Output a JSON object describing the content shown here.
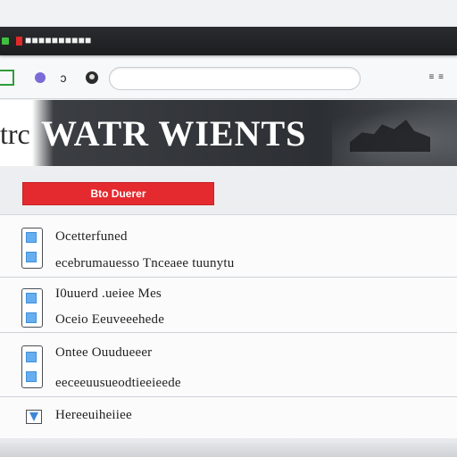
{
  "window": {
    "title": "■■■■■■■■■■"
  },
  "toolbar": {
    "refresh_glyph": "ɔ",
    "url_value": "",
    "menu_label": "≡ ≡"
  },
  "hero": {
    "prefix": "trc",
    "title": "WATR WIENTS"
  },
  "action_button": {
    "label": "Bto Duerer"
  },
  "list": {
    "items": [
      {
        "primary": "Ocetterfuned",
        "secondary": "ecebrumauesso Tnceaee tuunytu"
      },
      {
        "primary": "I0uuerd .ueiee Mes",
        "secondary": "Oceio Eeuveeehede"
      },
      {
        "primary": "Ontee Ouudueeer",
        "secondary": "eeceeuusueodtieeieede"
      },
      {
        "primary": "Hereeuiheiiee",
        "secondary": ""
      }
    ]
  },
  "colors": {
    "accent_red": "#e42a2f",
    "titlebar_dark": "#1c1d1f",
    "icon_blue": "#66aef0"
  }
}
